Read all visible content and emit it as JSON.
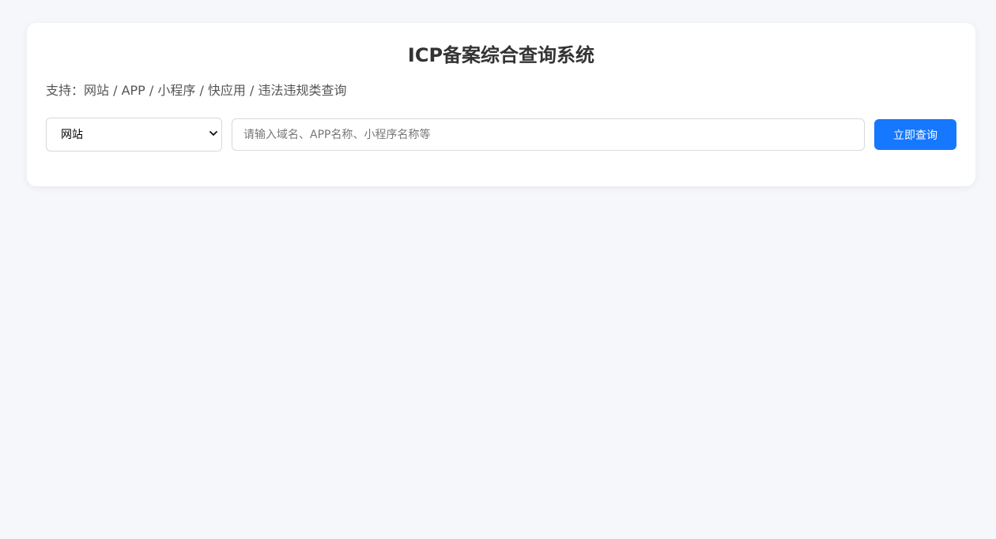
{
  "header": {
    "title": "ICP备案综合查询系统",
    "support_text": "支持：网站 / APP / 小程序 / 快应用 / 违法违规类查询"
  },
  "search": {
    "type_selected": "网站",
    "type_options": [
      "网站"
    ],
    "placeholder": "请输入域名、APP名称、小程序名称等",
    "value": "",
    "button_label": "立即查询"
  },
  "icons": {
    "select_arrow": "chevron-down-icon"
  },
  "colors": {
    "page_background": "#f5f7fb",
    "card_background": "#ffffff",
    "accent": "#1677ff",
    "title_text": "#333333",
    "secondary_text": "#555555"
  }
}
